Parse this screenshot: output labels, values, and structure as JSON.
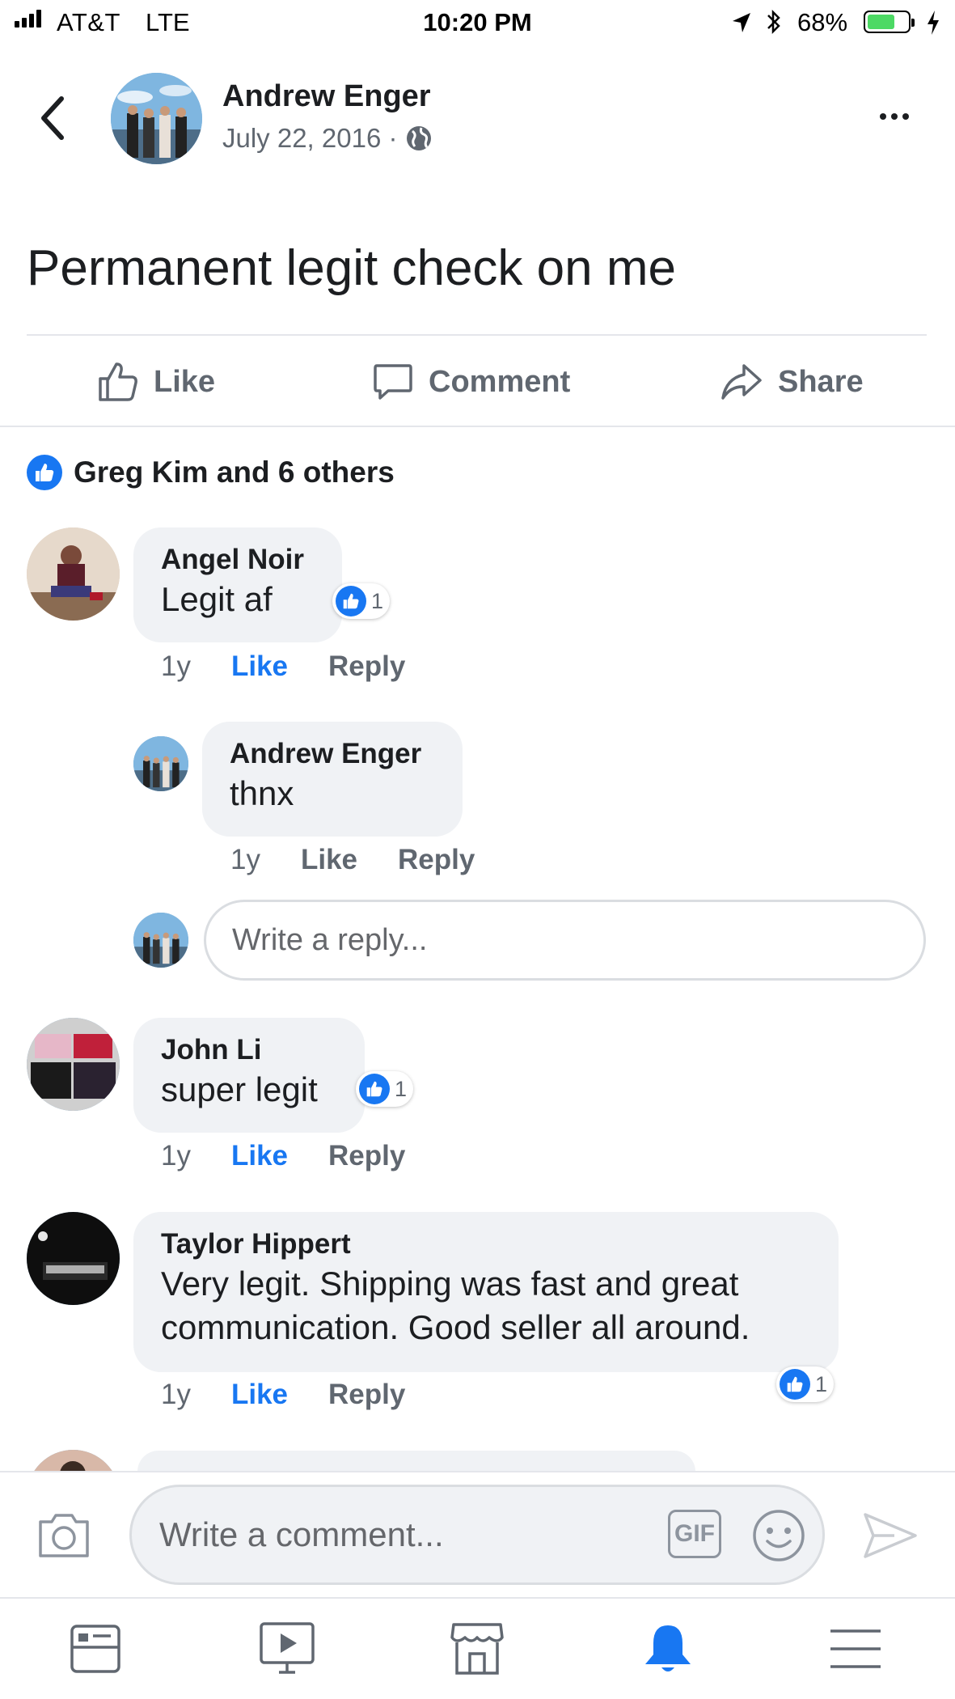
{
  "status_bar": {
    "carrier": "AT&T",
    "network": "LTE",
    "time": "10:20 PM",
    "battery_percent": "68%",
    "battery_level": 0.68
  },
  "post": {
    "author": "Andrew Enger",
    "date": "July 22, 2016 ·",
    "text": "Permanent legit check on me",
    "privacy_icon": "globe-icon"
  },
  "actions": {
    "like": "Like",
    "comment": "Comment",
    "share": "Share"
  },
  "reactions": {
    "summary": "Greg Kim and 6 others"
  },
  "comments": [
    {
      "name": "Angel Noir",
      "text": "Legit af",
      "reaction_count": "1",
      "age": "1y",
      "like_label": "Like",
      "reply_label": "Reply",
      "liked": true,
      "replies": [
        {
          "name": "Andrew Enger",
          "text": "thnx",
          "age": "1y",
          "like_label": "Like",
          "reply_label": "Reply",
          "liked": false
        }
      ]
    },
    {
      "name": "John Li",
      "text": "super legit",
      "reaction_count": "1",
      "age": "1y",
      "like_label": "Like",
      "reply_label": "Reply",
      "liked": true
    },
    {
      "name": "Taylor Hippert",
      "text_line1": "Very legit. Shipping was fast and great",
      "text_line2": "communication. Good seller all around.",
      "reaction_count": "1",
      "age": "1y",
      "like_label": "Like",
      "reply_label": "Reply",
      "liked": true
    }
  ],
  "reply_input": {
    "placeholder": "Write a reply..."
  },
  "composer": {
    "placeholder": "Write a comment...",
    "gif_label": "GIF"
  },
  "tab_bar": {
    "items": [
      "news-feed-icon",
      "watch-icon",
      "marketplace-icon",
      "notifications-icon",
      "menu-icon"
    ],
    "active": "notifications-icon"
  },
  "colors": {
    "accent": "#1877f2",
    "muted_text": "#606770",
    "bubble": "#f0f2f5"
  }
}
